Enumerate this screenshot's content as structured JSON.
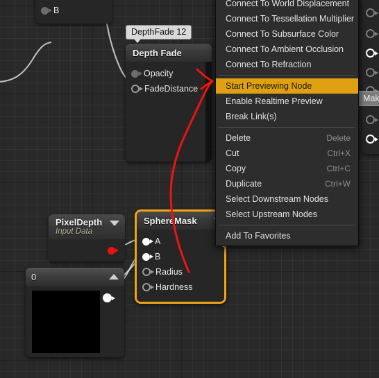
{
  "app": {
    "kind": "material-graph-editor",
    "grid_color": "#292929",
    "accent_color": "#dfa111",
    "selection_color": "#f0a317"
  },
  "context_menu": {
    "items": [
      {
        "label": "Connect To World Displacement",
        "shortcut": "",
        "highlight": false,
        "separator_after": false
      },
      {
        "label": "Connect To Tessellation Multiplier",
        "shortcut": "",
        "highlight": false,
        "separator_after": false
      },
      {
        "label": "Connect To Subsurface Color",
        "shortcut": "",
        "highlight": false,
        "separator_after": false
      },
      {
        "label": "Connect To Ambient Occlusion",
        "shortcut": "",
        "highlight": false,
        "separator_after": false
      },
      {
        "label": "Connect To Refraction",
        "shortcut": "",
        "highlight": false,
        "separator_after": true
      },
      {
        "label": "Start Previewing Node",
        "shortcut": "",
        "highlight": true,
        "separator_after": false
      },
      {
        "label": "Enable Realtime Preview",
        "shortcut": "",
        "highlight": false,
        "separator_after": false
      },
      {
        "label": "Break Link(s)",
        "shortcut": "",
        "highlight": false,
        "separator_after": true
      },
      {
        "label": "Delete",
        "shortcut": "Delete",
        "highlight": false,
        "separator_after": false
      },
      {
        "label": "Cut",
        "shortcut": "Ctrl+X",
        "highlight": false,
        "separator_after": false
      },
      {
        "label": "Copy",
        "shortcut": "Ctrl+C",
        "highlight": false,
        "separator_after": false
      },
      {
        "label": "Duplicate",
        "shortcut": "Ctrl+W",
        "highlight": false,
        "separator_after": false
      },
      {
        "label": "Select Downstream Nodes",
        "shortcut": "",
        "highlight": false,
        "separator_after": false
      },
      {
        "label": "Select Upstream Nodes",
        "shortcut": "",
        "highlight": false,
        "separator_after": true
      },
      {
        "label": "Add To Favorites",
        "shortcut": "",
        "highlight": false,
        "separator_after": false
      }
    ]
  },
  "nodes": {
    "b_node": {
      "pins": [
        {
          "label": "B",
          "style": "filled-gray"
        }
      ]
    },
    "depth_fade": {
      "title": "Depth Fade",
      "tooltip": "DepthFade 12",
      "pins": [
        {
          "label": "Opacity",
          "style": "filled-gray"
        },
        {
          "label": "FadeDistance",
          "style": "hollow"
        }
      ]
    },
    "pixel_depth": {
      "title": "PixelDepth",
      "subtitle": "Input Data",
      "output_pin_color": "#ee1111"
    },
    "sphere_mask": {
      "title": "SphereMask",
      "selected": true,
      "pins": [
        {
          "label": "A",
          "style": "filled-white"
        },
        {
          "label": "B",
          "style": "filled-white"
        },
        {
          "label": "Radius",
          "style": "hollow"
        },
        {
          "label": "Hardness",
          "style": "hollow"
        }
      ]
    },
    "constant": {
      "title": "0",
      "preview_color": "#000000"
    },
    "right_node": {
      "tooltip": "Mak"
    }
  }
}
